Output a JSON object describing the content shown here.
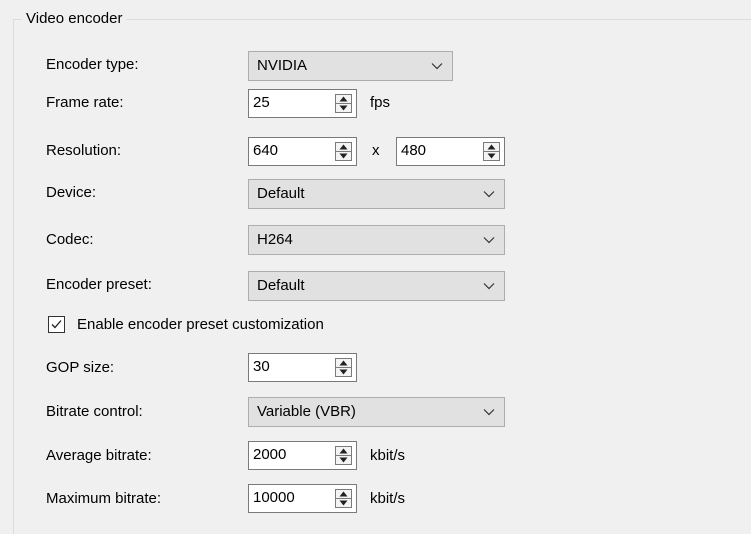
{
  "group": {
    "title": "Video encoder"
  },
  "encoder_type": {
    "label": "Encoder type:",
    "value": "NVIDIA"
  },
  "frame_rate": {
    "label": "Frame rate:",
    "value": "25",
    "unit": "fps"
  },
  "resolution": {
    "label": "Resolution:",
    "width": "640",
    "separator": "x",
    "height": "480"
  },
  "device": {
    "label": "Device:",
    "value": "Default"
  },
  "codec": {
    "label": "Codec:",
    "value": "H264"
  },
  "encoder_preset": {
    "label": "Encoder preset:",
    "value": "Default"
  },
  "preset_customization": {
    "label": "Enable encoder preset customization",
    "checked": true
  },
  "gop_size": {
    "label": "GOP size:",
    "value": "30"
  },
  "bitrate_control": {
    "label": "Bitrate control:",
    "value": "Variable (VBR)"
  },
  "average_bitrate": {
    "label": "Average bitrate:",
    "value": "2000",
    "unit": "kbit/s"
  },
  "maximum_bitrate": {
    "label": "Maximum bitrate:",
    "value": "10000",
    "unit": "kbit/s"
  },
  "icons": {
    "dropdown": "chevron-down-icon",
    "spin_up": "spin-up-arrow-icon",
    "spin_down": "spin-down-arrow-icon",
    "check": "checkmark-icon"
  }
}
